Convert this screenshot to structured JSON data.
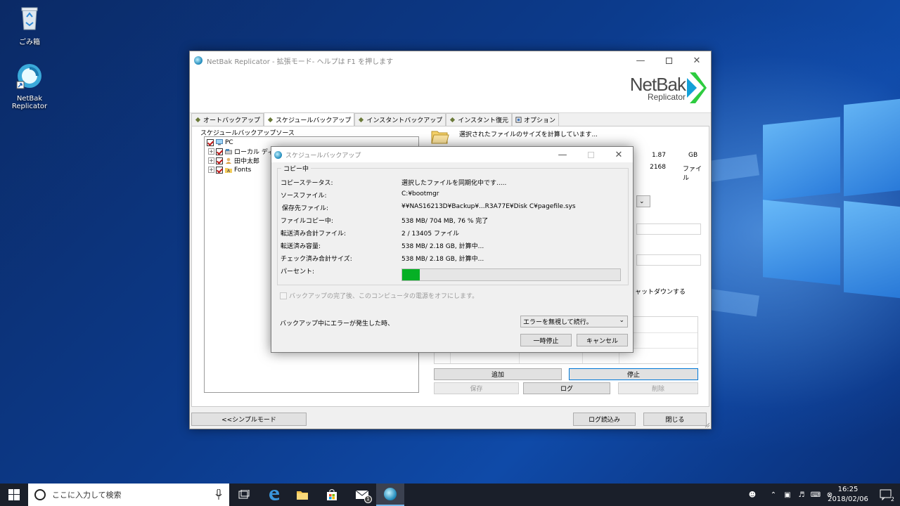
{
  "desktop": {
    "icons": [
      {
        "label": "ごみ箱",
        "icon": "recycle-bin-icon"
      },
      {
        "label": "NetBak Replicator",
        "icon": "netbak-app-icon"
      }
    ]
  },
  "main_window": {
    "title": "NetBak Replicator - 拡張モード- ヘルプは F1 を押します",
    "logo": {
      "line1": "NetBak",
      "line2": "Replicator"
    },
    "tabs": [
      {
        "label": "オートバックアップ",
        "icon": "auto-backup-icon"
      },
      {
        "label": "スケジュールバックアップ",
        "icon": "schedule-backup-icon"
      },
      {
        "label": "インスタントバックアップ",
        "icon": "instant-backup-icon"
      },
      {
        "label": "インスタント復元",
        "icon": "instant-restore-icon"
      },
      {
        "label": "オプション",
        "icon": "options-icon"
      }
    ],
    "source_label": "スケジュールバックアップソース",
    "tree": [
      {
        "label": "PC",
        "checked": true
      },
      {
        "label": "ローカル ディ",
        "checked": true
      },
      {
        "label": "田中太郎",
        "checked": true
      },
      {
        "label": "Fonts",
        "checked": true
      }
    ],
    "status_message": "選択されたファイルのサイズを計算しています...",
    "size_value": "1.87",
    "size_unit": "GB",
    "files_value": "2168",
    "files_unit": "ファイル",
    "shutdown_text": "ャットダウンする",
    "buttons": {
      "add": "追加",
      "stop": "停止",
      "save": "保存",
      "log": "ログ",
      "delete": "削除",
      "simple_mode": "<<シンプルモード",
      "load_log": "ログ読込み",
      "close": "閉じる"
    }
  },
  "dialog": {
    "title": "スケジュールバックアップ",
    "group_title": "コピー中",
    "rows": [
      {
        "label": "コピーステータス:",
        "value": "選択したファイルを同期化中です....."
      },
      {
        "label": "ソースファイル:",
        "value": "C:¥bootmgr"
      },
      {
        "label": "保存先ファイル:",
        "value": "¥¥NAS16213D¥Backup¥...R3A77E¥Disk C¥pagefile.sys"
      },
      {
        "label": "ファイルコピー中:",
        "value": "538 MB/ 704 MB,  76 % 完了"
      },
      {
        "label": "転送済み合計ファイル:",
        "value": "2 / 13405 ファイル"
      },
      {
        "label": "転送済み容量:",
        "value": "538 MB/ 2.18 GB,  計算中..."
      },
      {
        "label": "チェック済み合計サイズ:",
        "value": "538 MB/ 2.18 GB,  計算中..."
      },
      {
        "label": "パーセント:",
        "value": ""
      }
    ],
    "percent_progress": 0.08,
    "shutdown_checkbox": "バックアップの完了後、このコンピュータの電源をオフにします。",
    "error_label": "バックアップ中にエラーが発生した時、",
    "error_option": "エラーを無視して続行。",
    "pause_button": "一時停止",
    "cancel_button": "キャンセル"
  },
  "taskbar": {
    "search_placeholder": "ここに入力して検索",
    "time": "16:25",
    "date": "2018/02/06",
    "notification_count": "2",
    "mail_badge": "1"
  },
  "colors": {
    "progress": "#06b025",
    "accent": "#0078d7",
    "logo_green": "#2ecc40"
  }
}
